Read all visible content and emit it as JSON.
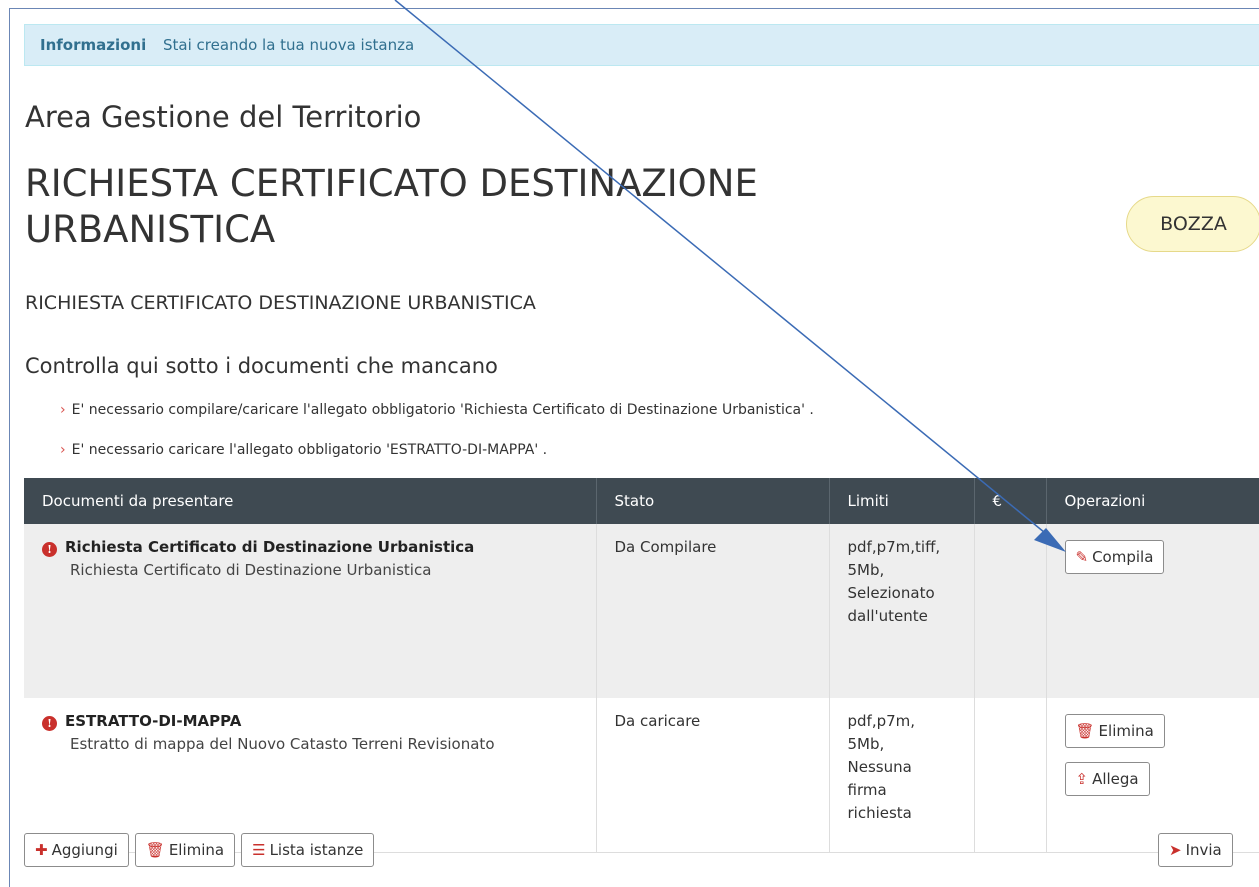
{
  "info": {
    "title": "Informazioni",
    "text": "Stai creando la tua nuova istanza"
  },
  "area_title": "Area Gestione del Territorio",
  "main_title": "RICHIESTA CERTIFICATO DESTINAZIONE URBANISTICA",
  "status": "BOZZA",
  "subtitle": "RICHIESTA CERTIFICATO DESTINAZIONE URBANISTICA",
  "check_title": "Controlla qui sotto i documenti che mancano",
  "missing": [
    "E' necessario compilare/caricare l'allegato obbligatorio 'Richiesta Certificato di Destinazione Urbanistica' .",
    "E' necessario caricare l'allegato obbligatorio 'ESTRATTO-DI-MAPPA' ."
  ],
  "table": {
    "headers": [
      "Documenti da presentare",
      "Stato",
      "Limiti",
      "€",
      "Operazioni"
    ],
    "rows": [
      {
        "name": "Richiesta Certificato di Destinazione Urbanistica",
        "description": "Richiesta Certificato di Destinazione Urbanistica",
        "state": "Da Compilare",
        "limits": [
          "pdf,p7m,tiff,",
          "5Mb,",
          "Selezionato",
          "dall'utente"
        ],
        "price": "",
        "ops": [
          "Compila"
        ]
      },
      {
        "name": "ESTRATTO-DI-MAPPA",
        "description": "Estratto di mappa del Nuovo Catasto Terreni Revisionato",
        "state": "Da caricare",
        "limits": [
          "pdf,p7m,",
          "5Mb,",
          "Nessuna",
          "firma",
          "richiesta"
        ],
        "price": "",
        "ops": [
          "Elimina",
          "Allega"
        ]
      }
    ]
  },
  "footer": {
    "add": "Aggiungi",
    "delete": "Elimina",
    "list": "Lista istanze",
    "send": "Invia"
  },
  "colors": {
    "info_bg": "#d9edf7",
    "table_header_bg": "#3f4a52",
    "accent_red": "#c9302c",
    "badge_bg": "#fcf8d0",
    "annotation_arrow": "#3b6bb5"
  },
  "icons": [
    "alert-icon",
    "pencil-icon",
    "trash-icon",
    "upload-icon",
    "plus-icon",
    "list-icon",
    "send-icon"
  ]
}
